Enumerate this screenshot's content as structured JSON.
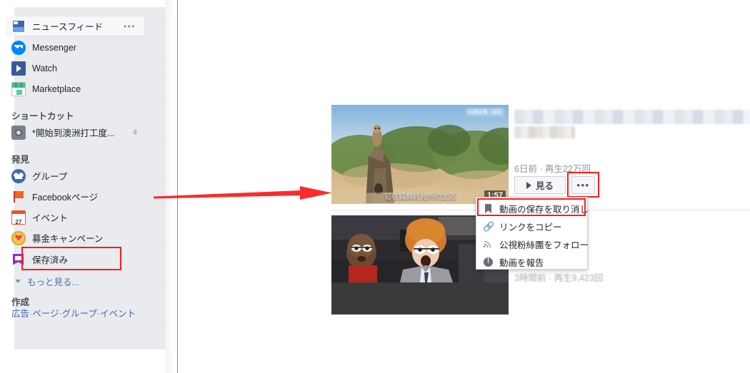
{
  "sidebar": {
    "main_items": [
      {
        "label": "ニュースフィード",
        "icon": "newsfeed-icon",
        "active": true,
        "menu_dots": "•••"
      },
      {
        "label": "Messenger",
        "icon": "messenger-icon",
        "active": false
      },
      {
        "label": "Watch",
        "icon": "watch-icon",
        "active": false
      },
      {
        "label": "Marketplace",
        "icon": "marketplace-icon",
        "active": false
      }
    ],
    "shortcuts_heading": "ショートカット",
    "shortcuts": [
      {
        "label": "*開始到澳洲打工度...",
        "icon": "camera-icon",
        "count": "4"
      }
    ],
    "explore_heading": "発見",
    "explore": [
      {
        "label": "グループ",
        "icon": "groups-icon"
      },
      {
        "label": "Facebookページ",
        "icon": "page-flag-icon"
      },
      {
        "label": "イベント",
        "icon": "calendar-icon"
      },
      {
        "label": "募金キャンペーン",
        "icon": "donate-heart-icon"
      },
      {
        "label": "保存済み",
        "icon": "saved-bookmark-icon",
        "highlighted": true
      }
    ],
    "see_more_label": "もっと見る...",
    "create_heading": "作成",
    "create_links": [
      "広告",
      "ページ",
      "グループ",
      "イベント"
    ],
    "create_separator": "·"
  },
  "annotations": {
    "arrow_color": "#fb2b2b",
    "box_color": "#ff1a1a"
  },
  "post": {
    "video1": {
      "duration": "1:57",
      "caption": "它在狐猬託見所的生活",
      "watermark": "公視記者 · 採訪",
      "title_blurred": true,
      "meta": "6日前 · 再生22万回",
      "watch_label": "見る",
      "more_label": "•••"
    },
    "video2": {
      "meta": "3時間前 · 再生9,423回"
    }
  },
  "dropdown": {
    "items": [
      {
        "label": "動画の保存を取り消し",
        "icon": "bookmark-icon",
        "highlighted": true
      },
      {
        "label": "リンクをコピー",
        "icon": "link-icon",
        "highlighted": false
      },
      {
        "label": "公視粉絲團をフォロー",
        "icon": "rss-icon",
        "highlighted": false
      },
      {
        "label": "動画を報告",
        "icon": "report-icon",
        "highlighted": false
      }
    ]
  }
}
